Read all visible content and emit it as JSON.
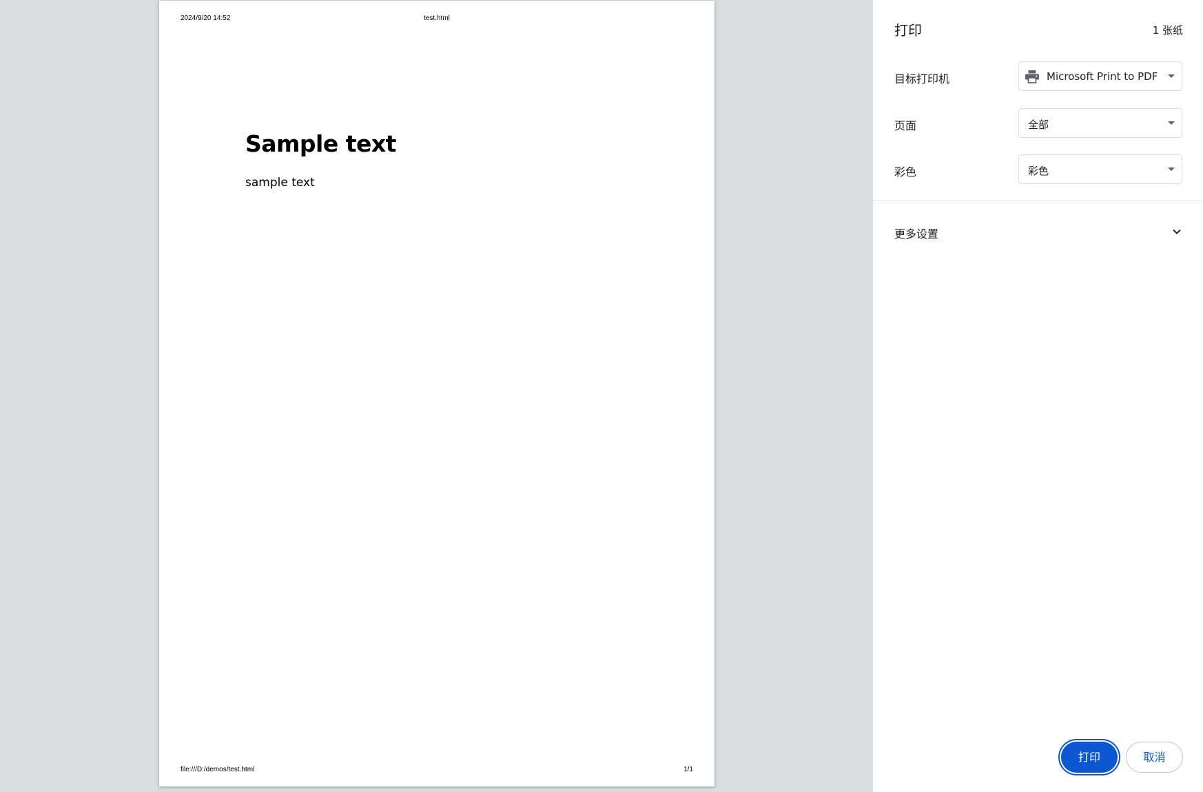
{
  "preview": {
    "header_left": "2024/9/20 14:52",
    "header_center": "test.html",
    "heading": "Sample text",
    "paragraph": "sample text",
    "footer_left": "file:///D:/demos/test.html",
    "footer_right": "1/1"
  },
  "sidebar": {
    "title": "打印",
    "sheet_count": "1 张纸",
    "destination": {
      "label": "目标打印机",
      "value": "Microsoft Print to PDF",
      "icon": "printer-icon"
    },
    "pages": {
      "label": "页面",
      "value": "全部"
    },
    "color": {
      "label": "彩色",
      "value": "彩色"
    },
    "more_settings": {
      "label": "更多设置",
      "icon": "chevron-down-icon"
    },
    "print_button": "打印",
    "cancel_button": "取消"
  },
  "colors": {
    "accent": "#0b57d0",
    "preview_background": "#dadce0",
    "text": "#202124"
  }
}
